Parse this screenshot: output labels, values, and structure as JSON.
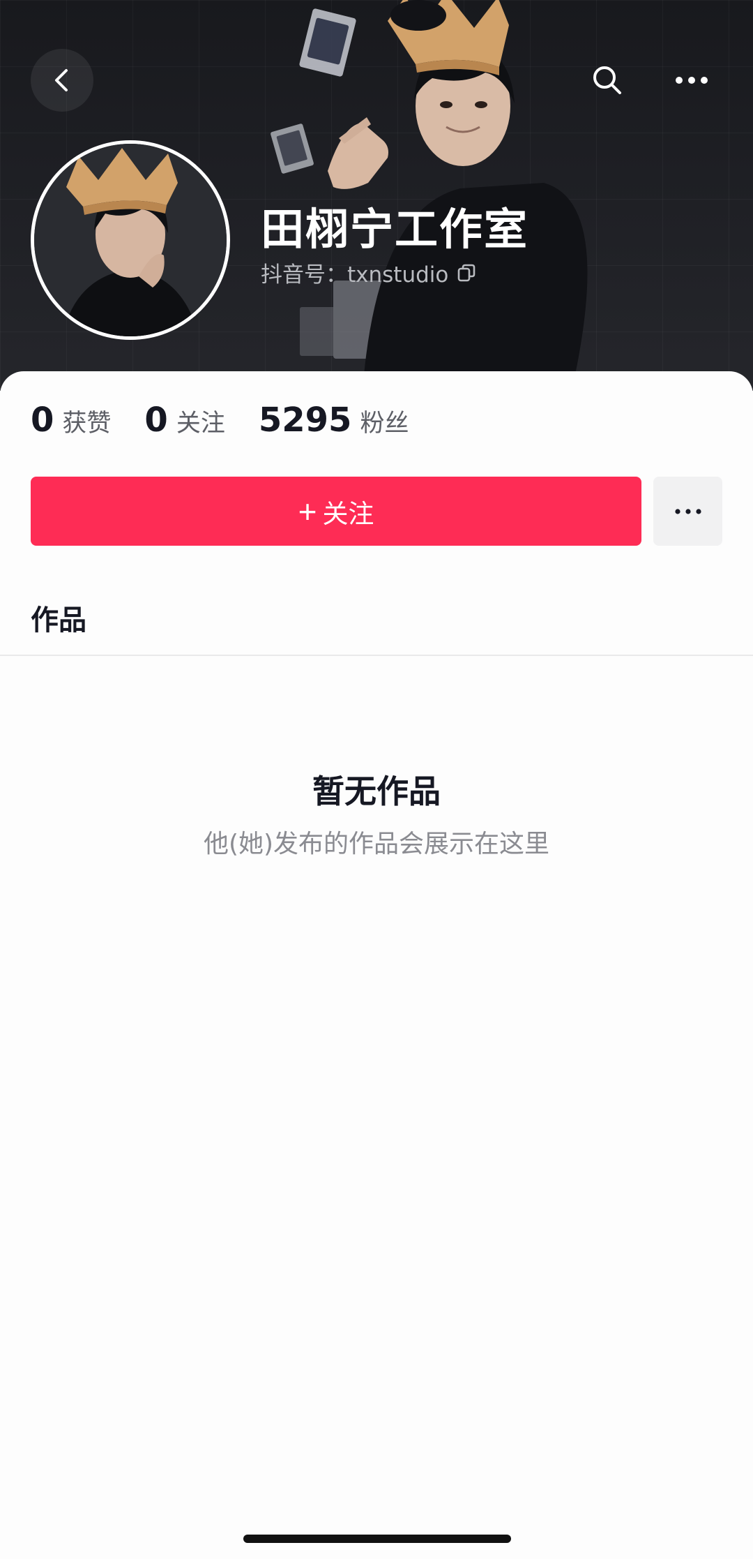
{
  "header": {
    "back_icon": "chevron-left-icon",
    "search_icon": "search-icon",
    "more_icon": "more-horizontal-icon"
  },
  "profile": {
    "name": "田栩宁工作室",
    "id_prefix": "抖音号：",
    "id_value": "txnstudio",
    "copy_icon": "copy-icon"
  },
  "stats": [
    {
      "number": "0",
      "label": "获赞"
    },
    {
      "number": "0",
      "label": "关注"
    },
    {
      "number": "5295",
      "label": "粉丝"
    }
  ],
  "actions": {
    "follow_plus": "+",
    "follow_label": "关注",
    "more_icon": "more-horizontal-icon"
  },
  "tabs": {
    "works": "作品"
  },
  "empty_state": {
    "title": "暂无作品",
    "description": "他(她)发布的作品会展示在这里"
  },
  "colors": {
    "accent": "#fe2c55",
    "banner_bg": "#1e1f24",
    "text_primary": "#161823",
    "text_secondary": "#8a8b91"
  }
}
